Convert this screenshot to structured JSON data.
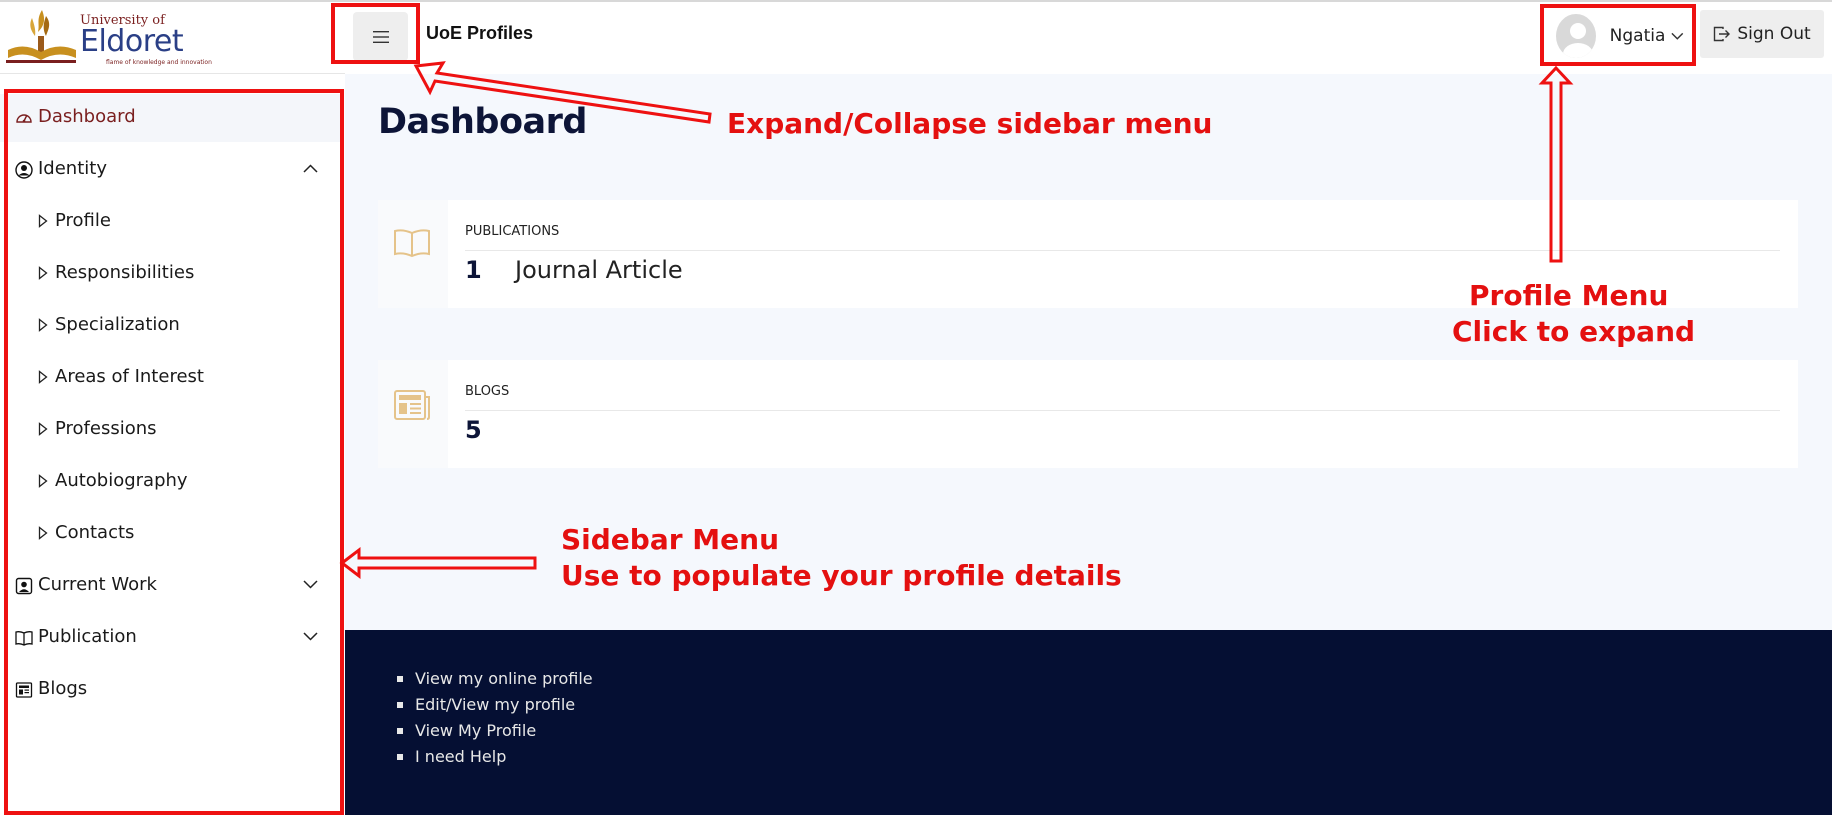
{
  "logo": {
    "line1": "University of",
    "line2": "Eldoret",
    "tagline": "flame of knowledge and innovation"
  },
  "header": {
    "app_title": "UoE Profiles",
    "user_name": "Ngatia",
    "sign_out": "Sign Out"
  },
  "sidebar": {
    "items": [
      {
        "label": "Dashboard",
        "icon": "speedometer-icon"
      },
      {
        "label": "Identity",
        "icon": "person-circle-icon",
        "expanded": true
      },
      {
        "label": "Profile"
      },
      {
        "label": "Responsibilities"
      },
      {
        "label": "Specialization"
      },
      {
        "label": "Areas of Interest"
      },
      {
        "label": "Professions"
      },
      {
        "label": "Autobiography"
      },
      {
        "label": "Contacts"
      },
      {
        "label": "Current Work",
        "icon": "person-badge-icon"
      },
      {
        "label": "Publication",
        "icon": "book-icon"
      },
      {
        "label": "Blogs",
        "icon": "newspaper-icon"
      }
    ]
  },
  "main": {
    "title": "Dashboard",
    "cards": [
      {
        "category": "PUBLICATIONS",
        "count": "1",
        "label": "Journal Article",
        "icon": "book-icon"
      },
      {
        "category": "BLOGS",
        "count": "5",
        "label": "",
        "icon": "newspaper-icon"
      }
    ]
  },
  "footer": {
    "links": [
      "View my online profile",
      "Edit/View my profile",
      "View My Profile",
      "I need Help"
    ]
  },
  "annotations": {
    "toggle_note": "Expand/Collapse sidebar menu",
    "profile_note_1": "Profile Menu",
    "profile_note_2": "Click to expand",
    "sidebar_note_1": "Sidebar Menu",
    "sidebar_note_2": "Use to populate your profile details"
  },
  "colors": {
    "accent_annotation": "#e41010",
    "footer_bg": "#050f33",
    "title": "#0d1538",
    "active_nav": "#7a1f1f",
    "card_icon": "#e5c38a"
  }
}
